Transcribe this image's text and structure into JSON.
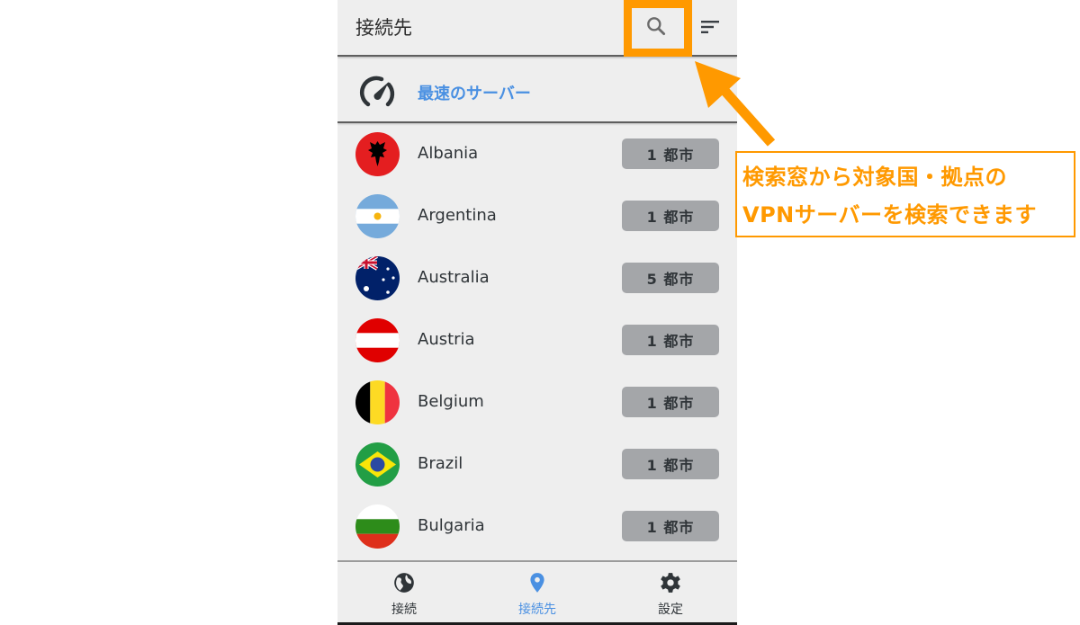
{
  "appbar": {
    "title": "接続先",
    "search_icon": "search-icon",
    "sort_icon": "sort-icon"
  },
  "fastest": {
    "icon": "speedometer-icon",
    "label": "最速のサーバー"
  },
  "countries": [
    {
      "name": "Albania",
      "cities": "1 都市",
      "flag": "albania-flag"
    },
    {
      "name": "Argentina",
      "cities": "1 都市",
      "flag": "argentina-flag"
    },
    {
      "name": "Australia",
      "cities": "5 都市",
      "flag": "australia-flag"
    },
    {
      "name": "Austria",
      "cities": "1 都市",
      "flag": "austria-flag"
    },
    {
      "name": "Belgium",
      "cities": "1 都市",
      "flag": "belgium-flag"
    },
    {
      "name": "Brazil",
      "cities": "1 都市",
      "flag": "brazil-flag"
    },
    {
      "name": "Bulgaria",
      "cities": "1 都市",
      "flag": "bulgaria-flag"
    }
  ],
  "bottom_nav": [
    {
      "label": "接続",
      "icon": "globe-icon",
      "active": false
    },
    {
      "label": "接続先",
      "icon": "location-pin-icon",
      "active": true
    },
    {
      "label": "設定",
      "icon": "gear-icon",
      "active": false
    }
  ],
  "annotation": {
    "line1": "検索窓から対象国・拠点の",
    "line2": "VPNサーバーを検索できます",
    "color": "#ff9900"
  },
  "colors": {
    "accent": "#4a90e2",
    "background": "#eeeeee",
    "badge": "#a4a6a9",
    "text": "#2f3438"
  }
}
